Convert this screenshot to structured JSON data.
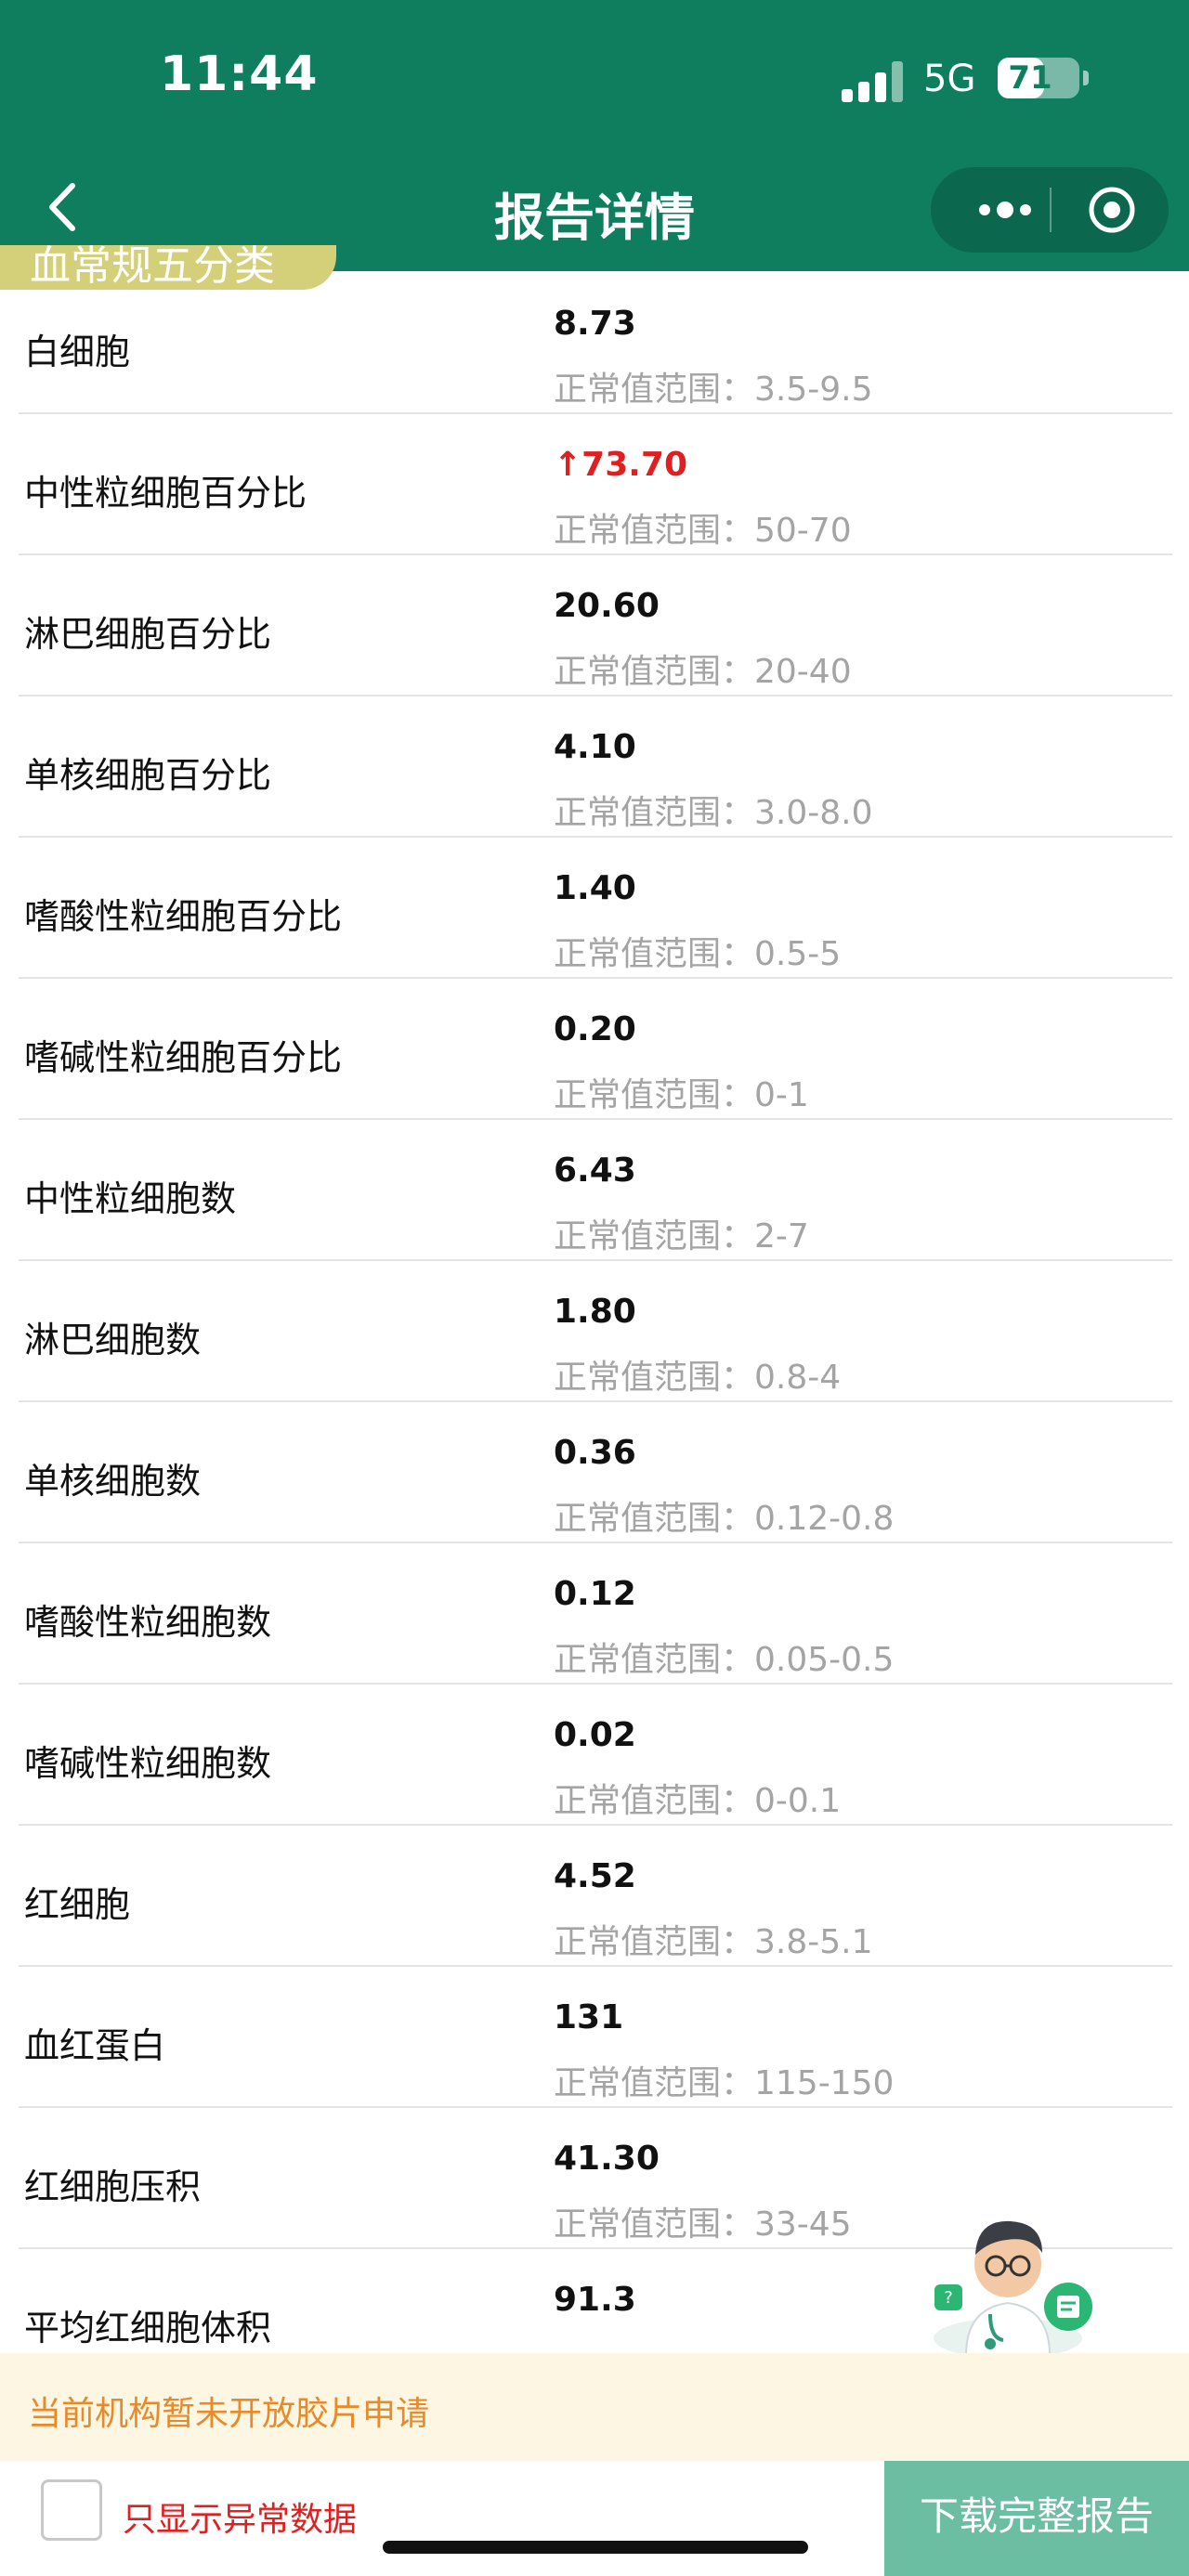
{
  "status_bar": {
    "time": "11:44",
    "network": "5G",
    "battery": "71",
    "battery_level": 0.71
  },
  "nav": {
    "title": "报告详情"
  },
  "section": {
    "label": "血常规五分类"
  },
  "results": [
    {
      "name": "白细胞",
      "value": "8.73",
      "range": "正常值范围：3.5-9.5",
      "abnormal": false
    },
    {
      "name": "中性粒细胞百分比",
      "value": "↑73.70",
      "range": "正常值范围：50-70",
      "abnormal": true
    },
    {
      "name": "淋巴细胞百分比",
      "value": "20.60",
      "range": "正常值范围：20-40",
      "abnormal": false
    },
    {
      "name": "单核细胞百分比",
      "value": "4.10",
      "range": "正常值范围：3.0-8.0",
      "abnormal": false
    },
    {
      "name": "嗜酸性粒细胞百分比",
      "value": "1.40",
      "range": "正常值范围：0.5-5",
      "abnormal": false
    },
    {
      "name": "嗜碱性粒细胞百分比",
      "value": "0.20",
      "range": "正常值范围：0-1",
      "abnormal": false
    },
    {
      "name": "中性粒细胞数",
      "value": "6.43",
      "range": "正常值范围：2-7",
      "abnormal": false
    },
    {
      "name": "淋巴细胞数",
      "value": "1.80",
      "range": "正常值范围：0.8-4",
      "abnormal": false
    },
    {
      "name": "单核细胞数",
      "value": "0.36",
      "range": "正常值范围：0.12-0.8",
      "abnormal": false
    },
    {
      "name": "嗜酸性粒细胞数",
      "value": "0.12",
      "range": "正常值范围：0.05-0.5",
      "abnormal": false
    },
    {
      "name": "嗜碱性粒细胞数",
      "value": "0.02",
      "range": "正常值范围：0-0.1",
      "abnormal": false
    },
    {
      "name": "红细胞",
      "value": "4.52",
      "range": "正常值范围：3.8-5.1",
      "abnormal": false
    },
    {
      "name": "血红蛋白",
      "value": "131",
      "range": "正常值范围：115-150",
      "abnormal": false
    },
    {
      "name": "红细胞压积",
      "value": "41.30",
      "range": "正常值范围：33-45",
      "abnormal": false
    },
    {
      "name": "平均红细胞体积",
      "value": "91.3",
      "range": "",
      "abnormal": false
    }
  ],
  "notice": {
    "text": "当前机构暂未开放胶片申请"
  },
  "footer": {
    "checkbox_label": "只显示异常数据",
    "download_label": "下载完整报告"
  },
  "colors": {
    "header": "#0e7e5f",
    "abnormal": "#e02020",
    "notice_text": "#e78a2a",
    "button": "#5fb99a"
  },
  "icons": [
    "back-chevron-icon",
    "more-dots-icon",
    "target-circle-icon",
    "doctor-assistant-icon"
  ]
}
